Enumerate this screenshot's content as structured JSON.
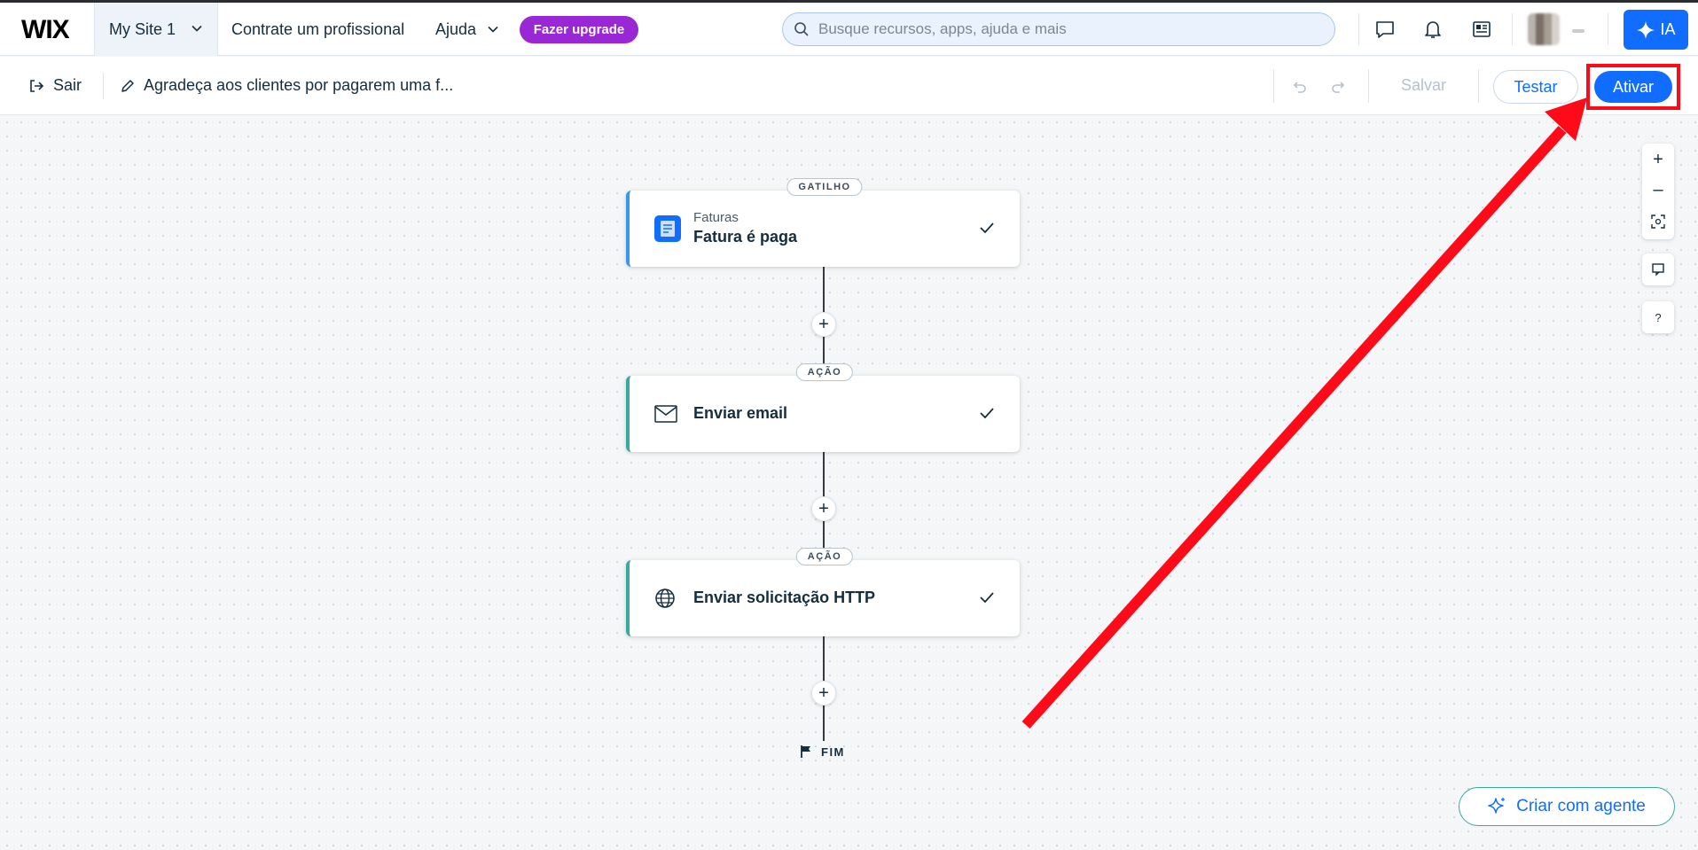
{
  "topbar": {
    "logo": "WIX",
    "site_name": "My Site 1",
    "hire_link": "Contrate um profissional",
    "help_link": "Ajuda",
    "upgrade_label": "Fazer upgrade",
    "search_placeholder": "Busque recursos, apps, ajuda e mais",
    "ai_label": "IA",
    "icons": [
      "chat-icon",
      "bell-icon",
      "news-icon"
    ]
  },
  "toolbar": {
    "exit_label": "Sair",
    "automation_title": "Agradeça aos clientes por pagarem uma f...",
    "save_label": "Salvar",
    "test_label": "Testar",
    "activate_label": "Ativar"
  },
  "flow": {
    "trigger": {
      "pill": "GATILHO",
      "app": "Faturas",
      "title": "Fatura é paga"
    },
    "actions": [
      {
        "pill": "AÇÃO",
        "title": "Enviar email",
        "icon": "envelope-icon"
      },
      {
        "pill": "AÇÃO",
        "title": "Enviar solicitação HTTP",
        "icon": "globe-icon"
      }
    ],
    "end_label": "FIM"
  },
  "side_controls": {
    "zoom_in": "+",
    "zoom_out": "–",
    "help": "?"
  },
  "agent_button": "Criar com agente",
  "colors": {
    "primary": "#116dff",
    "upgrade": "#9a27d5",
    "highlight": "#ff0a19",
    "action_accent": "#3ba7a1",
    "trigger_accent": "#3899ec"
  }
}
